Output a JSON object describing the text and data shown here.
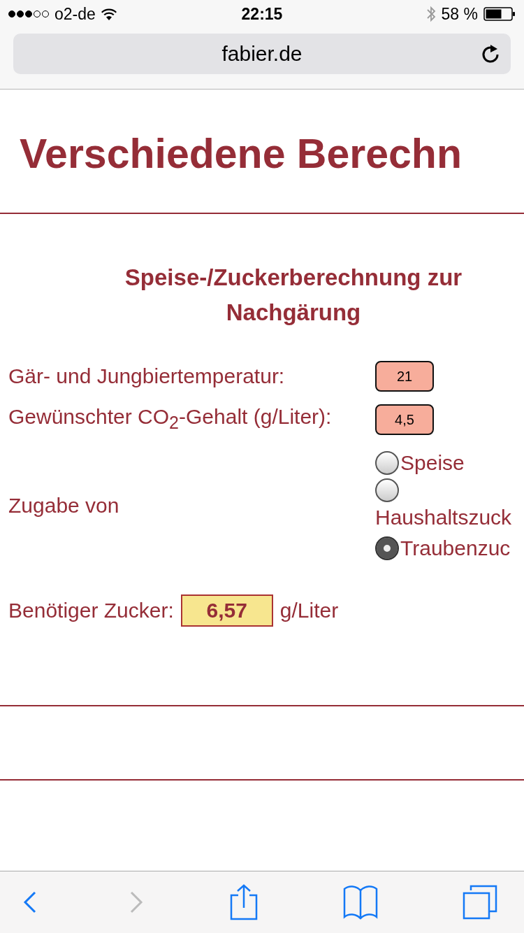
{
  "status_bar": {
    "carrier": "o2-de",
    "time": "22:15",
    "battery": "58 %"
  },
  "address_bar": {
    "url": "fabier.de"
  },
  "page": {
    "title": "Verschiedene Berechn",
    "section_title": "Speise-/Zuckerberechnung zur Nachgärung",
    "fields": [
      {
        "label": "Gär- und Jungbiertemperatur:",
        "value": "21"
      },
      {
        "label": "Gewünschter CO$_{2}$-Gehalt (g/Liter):",
        "value": "4,5"
      }
    ],
    "addition": {
      "label": "Zugabe von",
      "options": [
        {
          "label": "Speise",
          "selected": false
        },
        {
          "label": "Haushaltszuck",
          "selected": false
        },
        {
          "label": "Traubenzuc",
          "selected": true
        }
      ]
    },
    "result": {
      "label": "Benötiger Zucker:",
      "value": "6,57",
      "unit": "g/Liter"
    }
  },
  "toolbar": {
    "buttons": [
      {
        "kind": "back",
        "disabled": false
      },
      {
        "kind": "forward",
        "disabled": true
      },
      {
        "kind": "share",
        "disabled": false
      },
      {
        "kind": "bookmarks",
        "disabled": false
      },
      {
        "kind": "tabs",
        "disabled": false
      }
    ]
  }
}
